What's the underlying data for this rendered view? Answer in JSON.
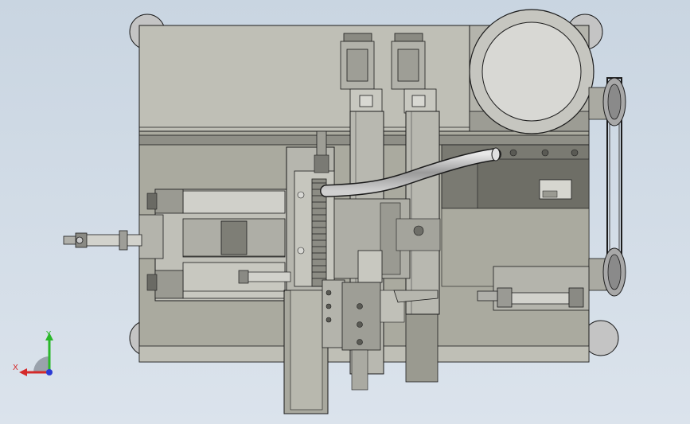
{
  "viewport": {
    "background_top": "#c9d5e1",
    "background_bottom": "#dbe3ec"
  },
  "triad": {
    "x_label": "X",
    "y_label": "Y",
    "x_color": "#d42a2a",
    "y_color": "#2ab82a",
    "z_color": "#2a3ad4"
  },
  "colors": {
    "frame": "#bfbfb6",
    "frame_dark": "#8f8f87",
    "plate": "#aaaa9f",
    "plate_dark": "#7a7a72",
    "edge": "#1c1c1c",
    "steel": "#c8c8c8",
    "hole_dark": "#5a5a54"
  }
}
